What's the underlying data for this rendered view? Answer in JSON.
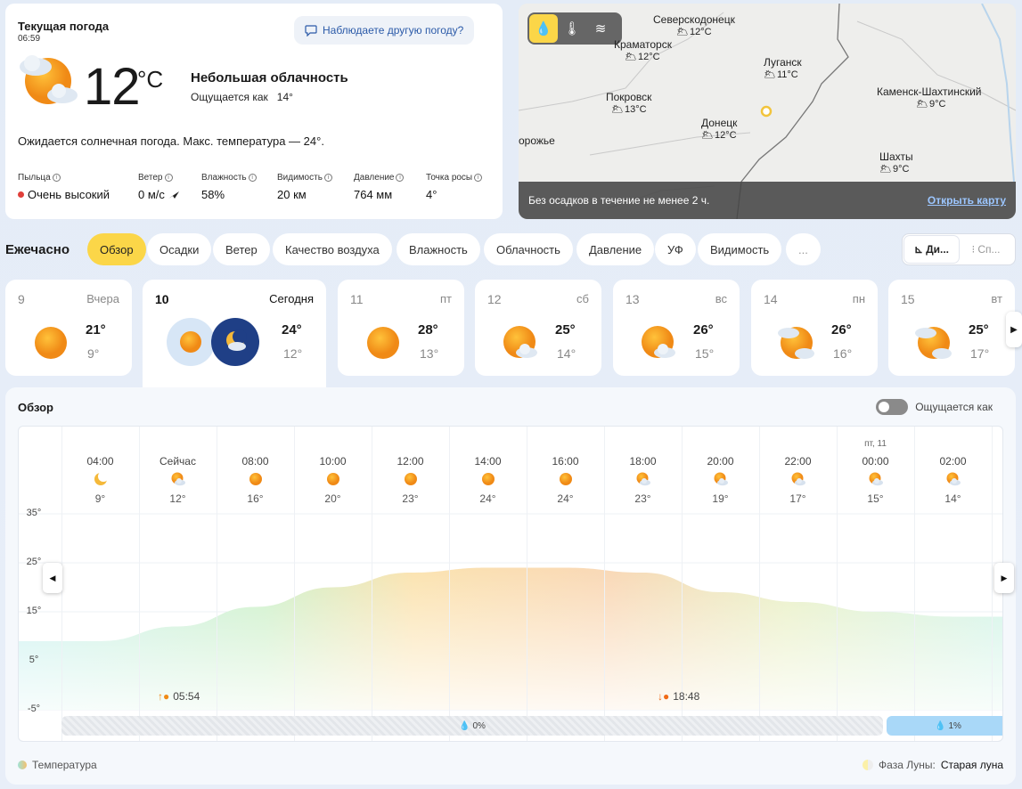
{
  "current": {
    "title": "Текущая погода",
    "time": "06:59",
    "ask": "Наблюдаете другую погоду?",
    "temp": "12",
    "unit": "°C",
    "condition": "Небольшая облачность",
    "feels_label": "Ощущается как",
    "feels_value": "14°",
    "forecast": "Ожидается солнечная погода. Макс. температура — 24°.",
    "stats": [
      {
        "label": "Пыльца",
        "value": "Очень высокий"
      },
      {
        "label": "Ветер",
        "value": "0 м/с"
      },
      {
        "label": "Влажность",
        "value": "58%"
      },
      {
        "label": "Видимость",
        "value": "20 км"
      },
      {
        "label": "Давление",
        "value": "764 мм"
      },
      {
        "label": "Точка росы",
        "value": "4°"
      }
    ]
  },
  "map": {
    "status": "Без осадков в течение не менее 2 ч.",
    "open": "Открыть карту",
    "edge_label": "орожье",
    "cities": [
      {
        "name": "Северскодонецк",
        "temp": "12°C"
      },
      {
        "name": "Краматорск",
        "temp": "12°C"
      },
      {
        "name": "Луганск",
        "temp": "11°C"
      },
      {
        "name": "Покровск",
        "temp": "13°C"
      },
      {
        "name": "Донецк",
        "temp": "12°C"
      },
      {
        "name": "Каменск-Шахтинский",
        "temp": "9°C"
      },
      {
        "name": "Шахты",
        "temp": "9°C"
      }
    ]
  },
  "tabs": {
    "label": "Ежечасно",
    "items": [
      "Обзор",
      "Осадки",
      "Ветер",
      "Качество воздуха",
      "Влажность",
      "Облачность",
      "Давление",
      "УФ",
      "Видимость",
      "..."
    ],
    "view1": "Ди...",
    "view2": "Сп..."
  },
  "days": [
    {
      "num": "9",
      "name": "Вчера",
      "hi": "21°",
      "lo": "9°"
    },
    {
      "num": "10",
      "name": "Сегодня",
      "hi": "24°",
      "lo": "12°"
    },
    {
      "num": "11",
      "name": "пт",
      "hi": "28°",
      "lo": "13°"
    },
    {
      "num": "12",
      "name": "сб",
      "hi": "25°",
      "lo": "14°"
    },
    {
      "num": "13",
      "name": "вс",
      "hi": "26°",
      "lo": "15°"
    },
    {
      "num": "14",
      "name": "пн",
      "hi": "26°",
      "lo": "16°"
    },
    {
      "num": "15",
      "name": "вт",
      "hi": "25°",
      "lo": "17°"
    }
  ],
  "overview": {
    "title": "Обзор",
    "feels_toggle": "Ощущается как",
    "sunrise": "05:54",
    "sunset": "18:48",
    "legend": "Температура",
    "moon_label": "Фаза Луны:",
    "moon_value": "Старая луна"
  },
  "chart_data": {
    "type": "area",
    "y_ticks": [
      "35°",
      "25°",
      "15°",
      "5°",
      "-5°"
    ],
    "ylim": [
      -5,
      35
    ],
    "x": [
      "04:00",
      "Сейчас",
      "08:00",
      "10:00",
      "12:00",
      "14:00",
      "16:00",
      "18:00",
      "20:00",
      "22:00",
      "00:00",
      "02:00"
    ],
    "day_label": "пт, 11",
    "values": [
      9,
      12,
      16,
      20,
      23,
      24,
      24,
      23,
      19,
      17,
      15,
      14
    ],
    "labels": [
      "9°",
      "12°",
      "16°",
      "20°",
      "23°",
      "24°",
      "24°",
      "23°",
      "19°",
      "17°",
      "15°",
      "14°"
    ],
    "precip": [
      {
        "label": "0%"
      },
      {
        "label": "1%"
      }
    ]
  }
}
